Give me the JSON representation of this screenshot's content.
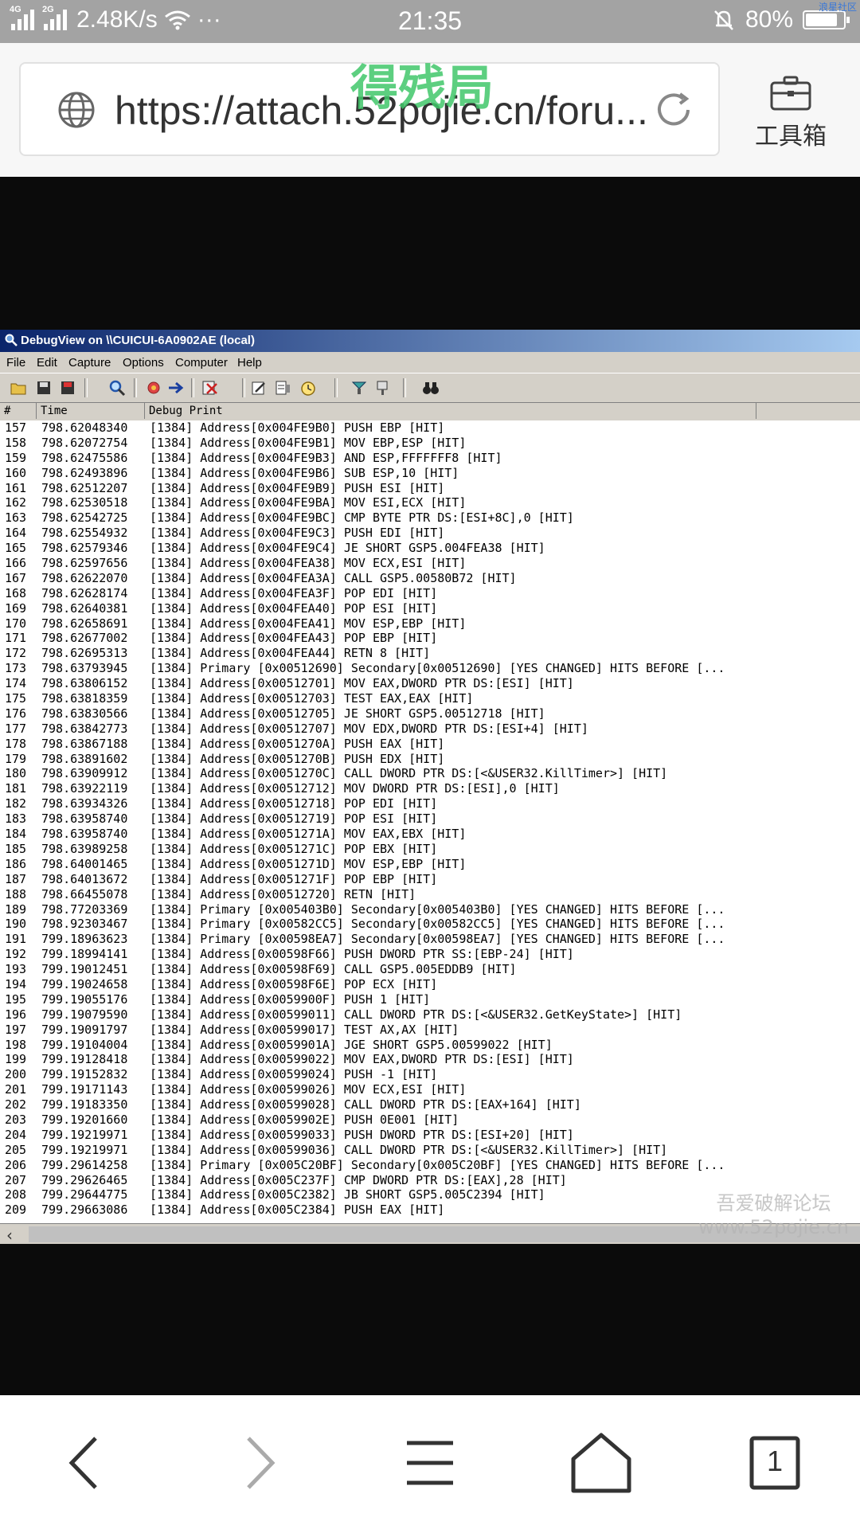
{
  "status_bar": {
    "net1": "4G",
    "net2": "2G",
    "speed": "2.48K/s",
    "dots": "···",
    "time": "21:35",
    "battery": "80%",
    "corner_tag": "浪星社区"
  },
  "browser": {
    "url": "https://attach.52pojie.cn/foru...",
    "watermark": "得残局",
    "toolbox_label": "工具箱"
  },
  "window": {
    "title": "DebugView on \\\\CUICUI-6A0902AE (local)",
    "menu": [
      "File",
      "Edit",
      "Capture",
      "Options",
      "Computer",
      "Help"
    ],
    "columns": [
      "#",
      "Time",
      "Debug Print"
    ],
    "rows": [
      [
        "157",
        "798.62048340",
        "[1384] Address[0x004FE9B0] PUSH EBP [HIT]"
      ],
      [
        "158",
        "798.62072754",
        "[1384] Address[0x004FE9B1] MOV EBP,ESP [HIT]"
      ],
      [
        "159",
        "798.62475586",
        "[1384] Address[0x004FE9B3] AND ESP,FFFFFFF8 [HIT]"
      ],
      [
        "160",
        "798.62493896",
        "[1384] Address[0x004FE9B6] SUB ESP,10 [HIT]"
      ],
      [
        "161",
        "798.62512207",
        "[1384] Address[0x004FE9B9] PUSH ESI [HIT]"
      ],
      [
        "162",
        "798.62530518",
        "[1384] Address[0x004FE9BA] MOV ESI,ECX [HIT]"
      ],
      [
        "163",
        "798.62542725",
        "[1384] Address[0x004FE9BC] CMP BYTE PTR DS:[ESI+8C],0 [HIT]"
      ],
      [
        "164",
        "798.62554932",
        "[1384] Address[0x004FE9C3] PUSH EDI [HIT]"
      ],
      [
        "165",
        "798.62579346",
        "[1384] Address[0x004FE9C4] JE SHORT GSP5.004FEA38 [HIT]"
      ],
      [
        "166",
        "798.62597656",
        "[1384] Address[0x004FEA38] MOV ECX,ESI [HIT]"
      ],
      [
        "167",
        "798.62622070",
        "[1384] Address[0x004FEA3A] CALL GSP5.00580B72 [HIT]"
      ],
      [
        "168",
        "798.62628174",
        "[1384] Address[0x004FEA3F] POP EDI [HIT]"
      ],
      [
        "169",
        "798.62640381",
        "[1384] Address[0x004FEA40] POP ESI [HIT]"
      ],
      [
        "170",
        "798.62658691",
        "[1384] Address[0x004FEA41] MOV ESP,EBP [HIT]"
      ],
      [
        "171",
        "798.62677002",
        "[1384] Address[0x004FEA43] POP EBP [HIT]"
      ],
      [
        "172",
        "798.62695313",
        "[1384] Address[0x004FEA44] RETN 8 [HIT]"
      ],
      [
        "173",
        "798.63793945",
        "[1384] Primary [0x00512690] Secondary[0x00512690] [YES CHANGED] HITS BEFORE [..."
      ],
      [
        "174",
        "798.63806152",
        "[1384] Address[0x00512701] MOV EAX,DWORD PTR DS:[ESI] [HIT]"
      ],
      [
        "175",
        "798.63818359",
        "[1384] Address[0x00512703] TEST EAX,EAX [HIT]"
      ],
      [
        "176",
        "798.63830566",
        "[1384] Address[0x00512705] JE SHORT GSP5.00512718 [HIT]"
      ],
      [
        "177",
        "798.63842773",
        "[1384] Address[0x00512707] MOV EDX,DWORD PTR DS:[ESI+4] [HIT]"
      ],
      [
        "178",
        "798.63867188",
        "[1384] Address[0x0051270A] PUSH EAX [HIT]"
      ],
      [
        "179",
        "798.63891602",
        "[1384] Address[0x0051270B] PUSH EDX [HIT]"
      ],
      [
        "180",
        "798.63909912",
        "[1384] Address[0x0051270C] CALL DWORD PTR DS:[<&USER32.KillTimer>] [HIT]"
      ],
      [
        "181",
        "798.63922119",
        "[1384] Address[0x00512712] MOV DWORD PTR DS:[ESI],0 [HIT]"
      ],
      [
        "182",
        "798.63934326",
        "[1384] Address[0x00512718] POP EDI [HIT]"
      ],
      [
        "183",
        "798.63958740",
        "[1384] Address[0x00512719] POP ESI [HIT]"
      ],
      [
        "184",
        "798.63958740",
        "[1384] Address[0x0051271A] MOV EAX,EBX [HIT]"
      ],
      [
        "185",
        "798.63989258",
        "[1384] Address[0x0051271C] POP EBX [HIT]"
      ],
      [
        "186",
        "798.64001465",
        "[1384] Address[0x0051271D] MOV ESP,EBP [HIT]"
      ],
      [
        "187",
        "798.64013672",
        "[1384] Address[0x0051271F] POP EBP [HIT]"
      ],
      [
        "188",
        "798.66455078",
        "[1384] Address[0x00512720] RETN [HIT]"
      ],
      [
        "189",
        "798.77203369",
        "[1384] Primary [0x005403B0] Secondary[0x005403B0] [YES CHANGED] HITS BEFORE [..."
      ],
      [
        "190",
        "798.92303467",
        "[1384] Primary [0x00582CC5] Secondary[0x00582CC5] [YES CHANGED] HITS BEFORE [..."
      ],
      [
        "191",
        "799.18963623",
        "[1384] Primary [0x00598EA7] Secondary[0x00598EA7] [YES CHANGED] HITS BEFORE [..."
      ],
      [
        "192",
        "799.18994141",
        "[1384] Address[0x00598F66] PUSH DWORD PTR SS:[EBP-24] [HIT]"
      ],
      [
        "193",
        "799.19012451",
        "[1384] Address[0x00598F69] CALL GSP5.005EDDB9 [HIT]"
      ],
      [
        "194",
        "799.19024658",
        "[1384] Address[0x00598F6E] POP ECX [HIT]"
      ],
      [
        "195",
        "799.19055176",
        "[1384] Address[0x0059900F] PUSH 1 [HIT]"
      ],
      [
        "196",
        "799.19079590",
        "[1384] Address[0x00599011] CALL DWORD PTR DS:[<&USER32.GetKeyState>] [HIT]"
      ],
      [
        "197",
        "799.19091797",
        "[1384] Address[0x00599017] TEST AX,AX [HIT]"
      ],
      [
        "198",
        "799.19104004",
        "[1384] Address[0x0059901A] JGE SHORT GSP5.00599022 [HIT]"
      ],
      [
        "199",
        "799.19128418",
        "[1384] Address[0x00599022] MOV EAX,DWORD PTR DS:[ESI] [HIT]"
      ],
      [
        "200",
        "799.19152832",
        "[1384] Address[0x00599024] PUSH -1 [HIT]"
      ],
      [
        "201",
        "799.19171143",
        "[1384] Address[0x00599026] MOV ECX,ESI [HIT]"
      ],
      [
        "202",
        "799.19183350",
        "[1384] Address[0x00599028] CALL DWORD PTR DS:[EAX+164] [HIT]"
      ],
      [
        "203",
        "799.19201660",
        "[1384] Address[0x0059902E] PUSH 0E001 [HIT]"
      ],
      [
        "204",
        "799.19219971",
        "[1384] Address[0x00599033] PUSH DWORD PTR DS:[ESI+20] [HIT]"
      ],
      [
        "205",
        "799.19219971",
        "[1384] Address[0x00599036] CALL DWORD PTR DS:[<&USER32.KillTimer>] [HIT]"
      ],
      [
        "206",
        "799.29614258",
        "[1384] Primary [0x005C20BF] Secondary[0x005C20BF] [YES CHANGED] HITS BEFORE [..."
      ],
      [
        "207",
        "799.29626465",
        "[1384] Address[0x005C237F] CMP DWORD PTR DS:[EAX],28 [HIT]"
      ],
      [
        "208",
        "799.29644775",
        "[1384] Address[0x005C2382] JB SHORT GSP5.005C2394 [HIT]"
      ],
      [
        "209",
        "799.29663086",
        "[1384] Address[0x005C2384] PUSH EAX [HIT]"
      ]
    ],
    "watermark_line1": "吾爱破解论坛",
    "watermark_line2": "www.52pojie.cn"
  },
  "navbar": {
    "tab_count": "1"
  }
}
